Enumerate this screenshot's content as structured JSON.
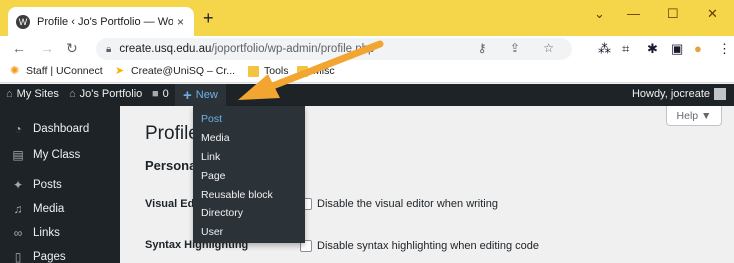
{
  "browser": {
    "tab_title": "Profile ‹ Jo's Portfolio — WordPress",
    "tab_close": "×",
    "new_tab": "+",
    "window_controls": {
      "minimize": "—",
      "maximize": "☐",
      "close": "✕",
      "dropdown": "⌄"
    },
    "url_host": "create.usq.edu.au",
    "url_path": "/joportfolio/wp-admin/profile.php",
    "bookmarks": [
      {
        "label": "Staff | UConnect",
        "icon": "uconnect-icon"
      },
      {
        "label": "Create@UniSQ – Cr...",
        "icon": "unisq-icon"
      },
      {
        "label": "Tools",
        "icon": "folder-icon"
      },
      {
        "label": "Misc",
        "icon": "folder-icon"
      }
    ]
  },
  "adminbar": {
    "my_sites": "My Sites",
    "site_name": "Jo's Portfolio",
    "comments_count": "0",
    "new_label": "New",
    "howdy": "Howdy, jocreate"
  },
  "sidebar": {
    "items": [
      {
        "label": "Dashboard",
        "icon": "dashboard-icon"
      },
      {
        "label": "My Class",
        "icon": "class-icon"
      },
      {
        "label": "Posts",
        "icon": "pin-icon"
      },
      {
        "label": "Media",
        "icon": "media-icon"
      },
      {
        "label": "Links",
        "icon": "links-icon"
      },
      {
        "label": "Pages",
        "icon": "pages-icon"
      }
    ]
  },
  "content": {
    "page_title": "Profile",
    "help": "Help ▼",
    "section_title": "Personal",
    "rows": [
      {
        "label": "Visual Editor",
        "text": "Disable the visual editor when writing"
      },
      {
        "label": "Syntax Highlighting",
        "text": "Disable syntax highlighting when editing code"
      }
    ]
  },
  "new_menu": {
    "items": [
      "Post",
      "Media",
      "Link",
      "Page",
      "Reusable block",
      "Directory",
      "User"
    ]
  },
  "colors": {
    "tabstrip": "#f5d64a",
    "adminbar": "#1d2327",
    "accent": "#72aee6",
    "arrow": "#f2a531"
  }
}
